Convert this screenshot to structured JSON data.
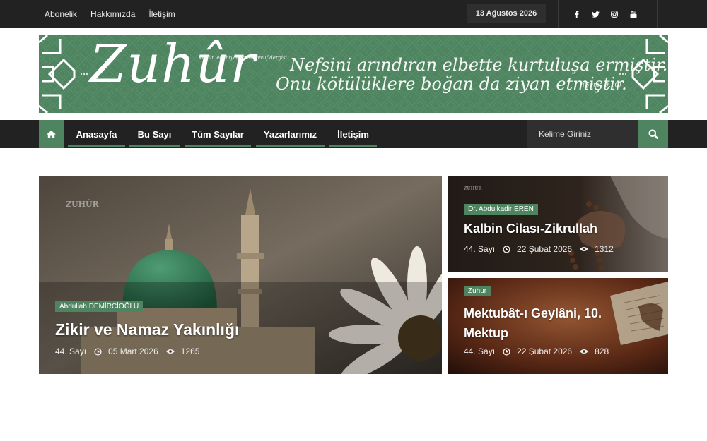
{
  "topbar": {
    "links": [
      "Abonelik",
      "Hakkımızda",
      "İletişim"
    ],
    "date": "13 Ağustos 2026",
    "social_icons": [
      "facebook-icon",
      "twitter-icon",
      "instagram-icon",
      "youtube-icon"
    ]
  },
  "banner": {
    "logo": "Zuhûr",
    "logo_sub": "kültür, edebiyat ve tasavvuf dergisi",
    "motto_line1": "Nefsini arındıran elbette kurtuluşa ermiştir.",
    "motto_line2": "Onu kötülüklere boğan da ziyan etmiştir.",
    "motto_ref": "(Şems-9,10)"
  },
  "nav": {
    "home_icon": "home-icon",
    "items": [
      "Anasayfa",
      "Bu Sayı",
      "Tüm Sayılar",
      "Yazarlarımız",
      "İletişim"
    ],
    "search_placeholder": "Kelime Giriniz",
    "search_icon": "search-icon"
  },
  "cards": [
    {
      "watermark": "ZUHÛR",
      "author": "Abdullah DEMİRCİOĞLU",
      "title": "Zikir ve Namaz Yakınlığı",
      "issue": "44. Sayı",
      "date": "05 Mart 2026",
      "views": "1265"
    },
    {
      "watermark": "ZUHÛR",
      "author": "Dr. Abdulkadir EREN",
      "title": "Kalbin Cilası-Zikrullah",
      "issue": "44. Sayı",
      "date": "22 Şubat 2026",
      "views": "1312"
    },
    {
      "author": "Zuhur",
      "title_line1": "Mektubât-ı Geylâni, 10.",
      "title_line2": "Mektup",
      "issue": "44. Sayı",
      "date": "22 Şubat 2026",
      "views": "828"
    }
  ],
  "colors": {
    "accent": "#4f8460",
    "topbar": "#222222",
    "nav": "#222222"
  }
}
